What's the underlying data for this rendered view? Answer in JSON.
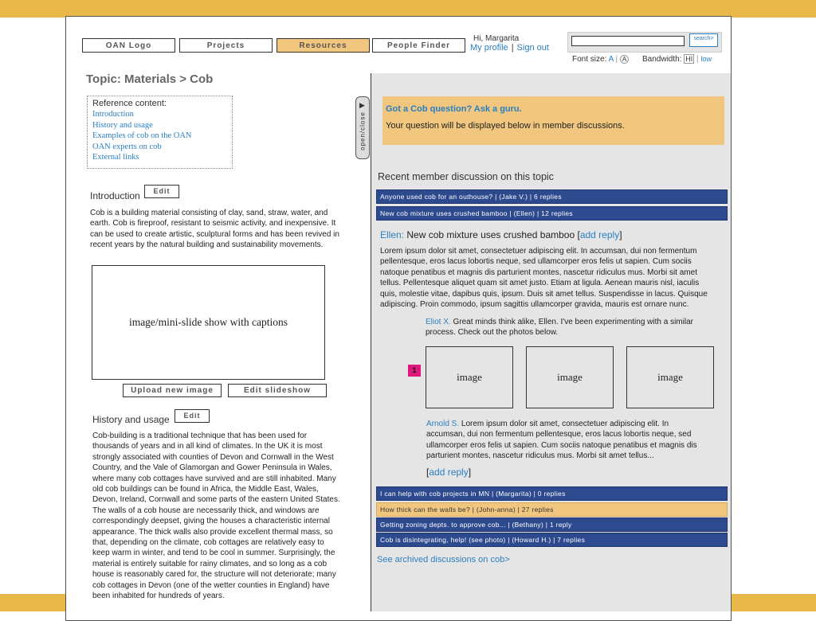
{
  "nav": {
    "logo": "OAN Logo",
    "projects": "Projects",
    "resources": "Resources",
    "people_finder": "People Finder"
  },
  "user": {
    "greeting": "Hi, Margarita",
    "my_profile": "My profile",
    "sign_out": "Sign out"
  },
  "search": {
    "placeholder": "",
    "button": "search>"
  },
  "settings": {
    "font_size_label": "Font size:",
    "font_a_small": "A",
    "font_a_large": "A",
    "bandwidth_label": "Bandwidth:",
    "bandwidth_hi": "HI",
    "bandwidth_low": "low"
  },
  "topic": "Topic: Materials > Cob",
  "reference": {
    "title": "Reference content:",
    "links": [
      "Introduction",
      "History and usage",
      "Examples of cob on the OAN",
      "OAN experts on cob",
      "External links"
    ]
  },
  "intro": {
    "heading": "Introduction",
    "edit": "Edit",
    "lines": [
      "Cob is a building material consisting of clay, sand, straw, water, and",
      "earth. Cob is fireproof, resistant to seismic activity, and inexpensive. It",
      "can be used to create artistic, sculptural forms and has been revived in",
      "recent years by the natural building and sustainability movements."
    ]
  },
  "slideshow": {
    "caption": "image/mini-slide show with captions",
    "upload": "Upload new image",
    "edit": "Edit slideshow"
  },
  "history": {
    "heading": "History and usage",
    "edit": "Edit",
    "lines": [
      "Cob-building is a traditional technique that has been used for",
      "thousands of years and in all kind of climates. In the UK it is most",
      "strongly associated with counties of Devon and Cornwall in the West",
      "Country, and the Vale of Glamorgan and Gower Peninsula in Wales,",
      "where many cob cottages have survived and are still inhabited. Many",
      "old cob buildings can be found in Africa, the Middle East, Wales,",
      "Devon, Ireland, Cornwall and some parts of the eastern United States.",
      "The walls of a cob house are necessarily thick, and windows are",
      "correspondingly deepset, giving the houses a characteristic internal",
      "appearance. The thick walls also provide excellent thermal mass, so",
      "that, depending on the climate, cob cottages are relatively easy to",
      "keep warm in winter, and tend to be cool in summer. Surprisingly, the",
      "material is entirely suitable for rainy climates, and so long as a cob",
      "house is reasonably cared for, the structure will not deteriorate; many",
      "cob cottages in Devon (one of the wetter counties in England) have",
      "been inhabited for hundreds of years."
    ]
  },
  "open_close": "open/close",
  "guru": {
    "question": "Got a Cob question? Ask a guru.",
    "subtext": "Your question will be displayed below in member discussions."
  },
  "recent_heading": "Recent member discussion on this topic",
  "discussions_top": [
    "Anyone used cob for an outhouse? | (Jake V.) | 6 replies",
    "New cob mixture uses crushed bamboo | (Ellen) | 12 replies"
  ],
  "thread": {
    "author": "Ellen:",
    "title": "New cob mixture uses crushed bamboo",
    "add_reply": "add reply",
    "body": [
      "Lorem ipsum dolor sit amet, consectetuer adipiscing elit. In accumsan, dui non fermentum",
      "pellentesque, eros lacus lobortis neque, sed ullamcorper eros felis ut sapien. Cum sociis",
      "natoque penatibus et magnis dis parturient montes, nascetur ridiculus mus. Morbi sit amet",
      "tellus. Pellentesque aliquet quam sit amet justo. Etiam at ligula. Aenean mauris nisl, iaculis",
      "quis, molestie vitae, dapibus quis, ipsum. Duis sit amet tellus. Suspendisse in lacus. Quisque",
      "adipiscing. Proin commodo, ipsum sagittis ullamcorper gravida, mauris est ornare nunc."
    ],
    "reply1_author": "Eliot X.",
    "reply1_lines": [
      "Great minds think alike, Ellen. I've been experimenting with a similar",
      "process. Check out the photos below."
    ],
    "badge": "1",
    "images": [
      "image",
      "image",
      "image"
    ],
    "reply2_author": "Arnold S.",
    "reply2_lines": [
      "Lorem ipsum dolor sit amet, consectetuer adipiscing elit. In",
      "accumsan, dui non fermentum pellentesque, eros lacus lobortis neque, sed",
      "ullamcorper eros felis ut sapien. Cum sociis natoque penatibus et magnis dis",
      "parturient montes, nascetur ridiculus mus. Morbi sit amet tellus..."
    ],
    "add_reply_bottom": "add reply"
  },
  "discussions_bottom": [
    "I can help with cob projects in MN | (Margarita) | 0 replies",
    "How thick can the walls be? | (John-anna) | 27 replies",
    "Getting zoning depts. to approve cob... | (Bethany) | 1 reply",
    "Cob is disintegrating, help! (see photo) | (Howard H.) | 7 replies"
  ],
  "archived": "See archived discussions on cob>",
  "colors": {
    "accent_gold": "#e9b84a",
    "highlight": "#f1c67e",
    "link_blue": "#2a7fc0",
    "discussion_navy": "#2e4a8f",
    "badge_pink": "#e0167f"
  }
}
